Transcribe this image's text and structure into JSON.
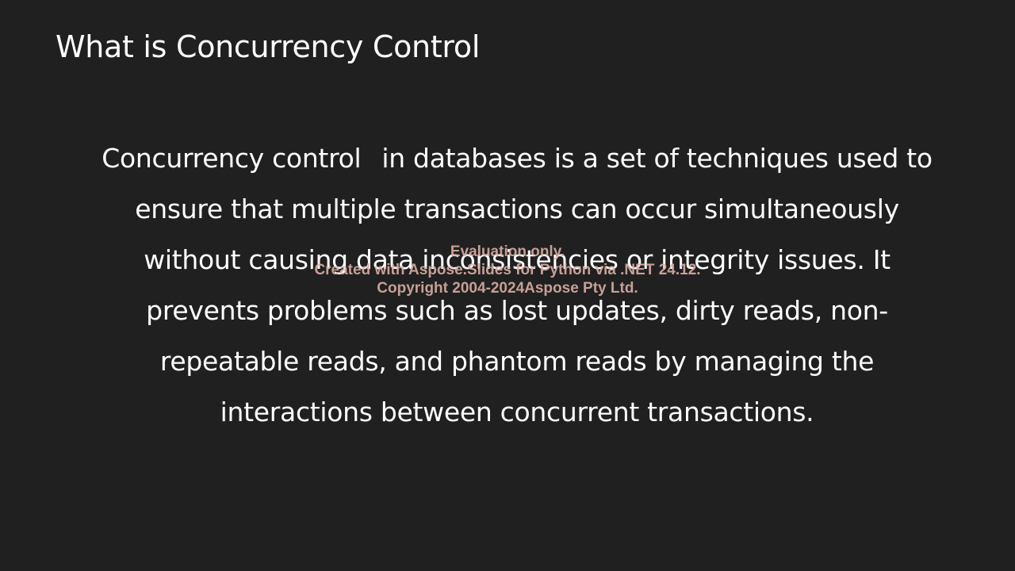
{
  "slide": {
    "title": "What is Concurrency Control",
    "body": {
      "lines": [
        {
          "a": "Concurrency control",
          "b": "in databases is a set of techniques used to"
        },
        {
          "text": "ensure that multiple transactions can occur simultaneously"
        },
        {
          "text": "without causing data inconsistencies or integrity issues. It"
        },
        {
          "text": "prevents problems such as lost updates, dirty reads, non-"
        },
        {
          "text": "repeatable reads, and phantom reads by managing the"
        },
        {
          "text": "interactions between concurrent transactions."
        }
      ]
    },
    "watermark": {
      "line1": "Evaluation only.",
      "line2": "Created with Aspose.Slides for Python via .NET 24.12.",
      "line3": "Copyright 2004-2024Aspose Pty Ltd."
    }
  },
  "colors": {
    "background": "#202020",
    "text": "#ffffff",
    "watermark": "#deb0a8"
  }
}
